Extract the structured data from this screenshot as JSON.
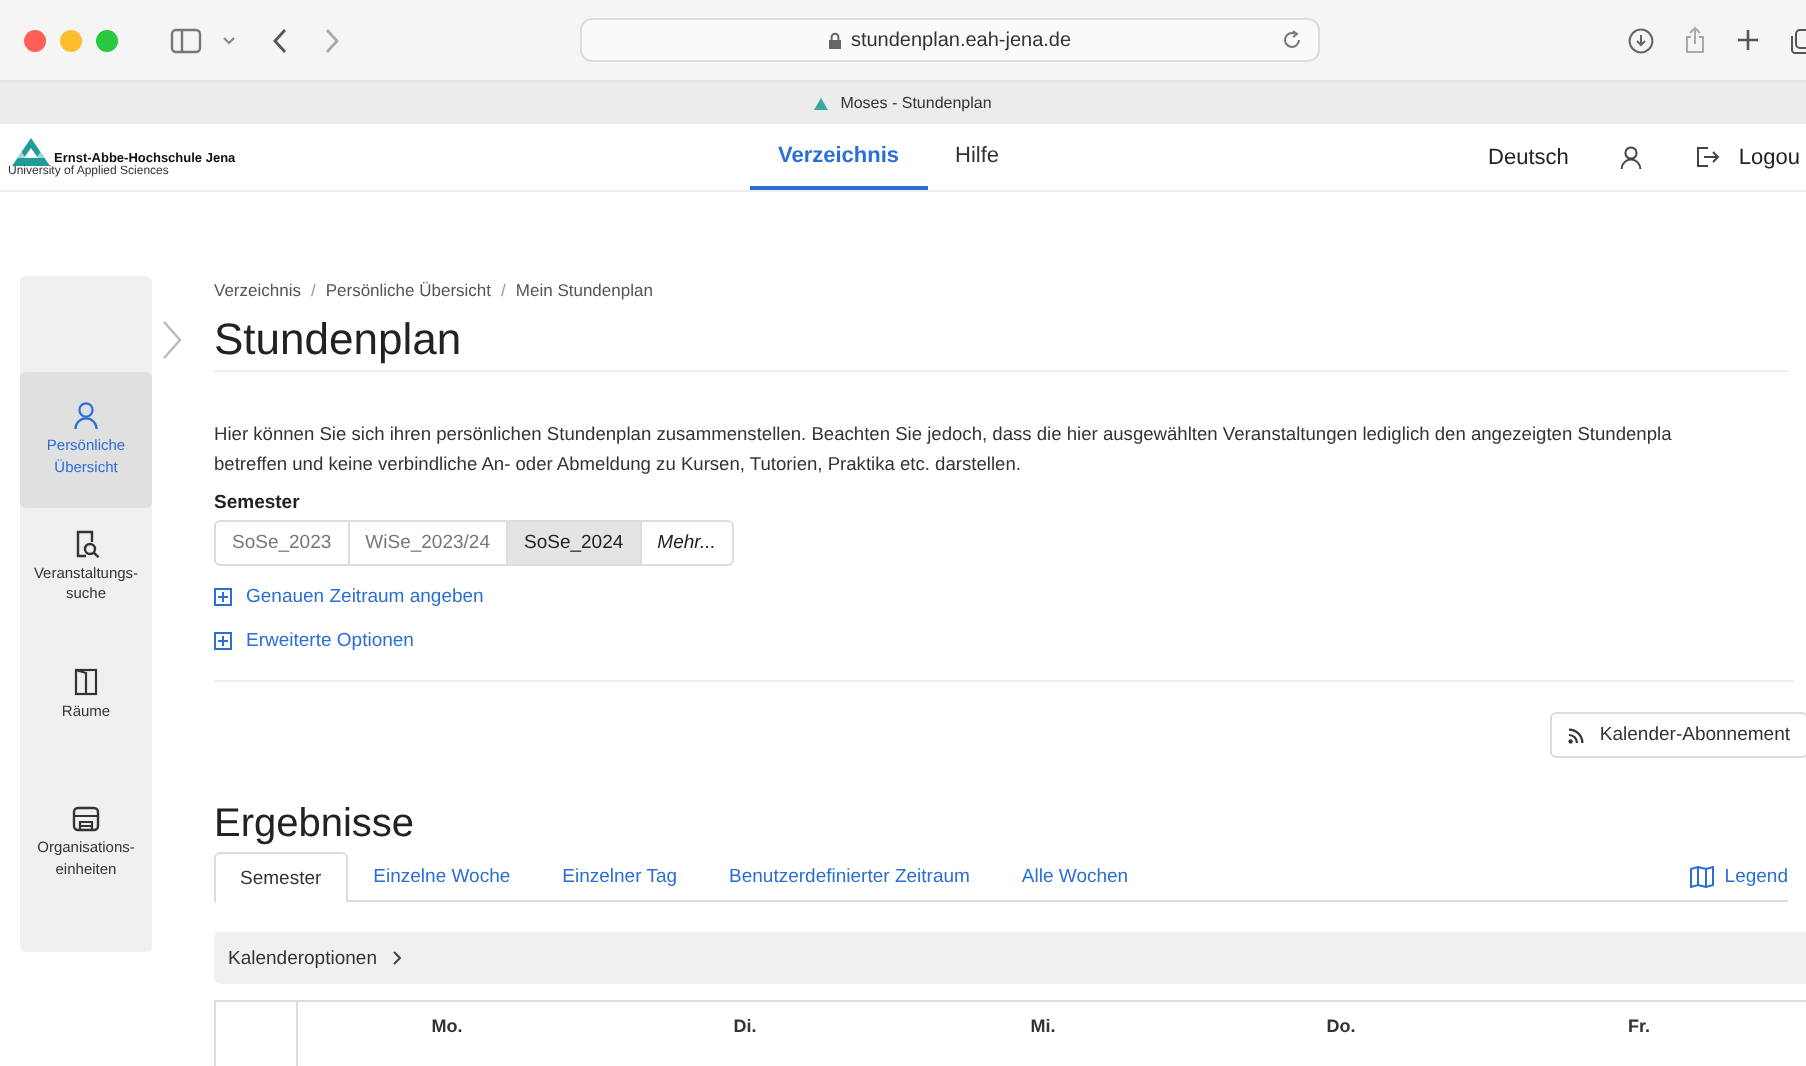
{
  "browser": {
    "url": "stundenplan.eah-jena.de",
    "tab_title": "Moses - Stundenplan"
  },
  "header": {
    "logo_name": "Ernst-Abbe-Hochschule Jena",
    "logo_subtitle": "University of Applied Sciences",
    "nav": [
      {
        "label": "Verzeichnis",
        "selected": true
      },
      {
        "label": "Hilfe",
        "selected": false
      }
    ],
    "language": "Deutsch",
    "logout": "Logou"
  },
  "sidebar": {
    "items": [
      {
        "label": "Persönliche Übersicht",
        "selected": true
      },
      {
        "label": "Veranstaltungs-suche",
        "selected": false
      },
      {
        "label": "Räume",
        "selected": false
      },
      {
        "label": "Organisations-einheiten",
        "selected": false
      }
    ]
  },
  "breadcrumb": [
    {
      "label": "Verzeichnis"
    },
    {
      "separator": "/",
      "label": "Persönliche Übersicht"
    },
    {
      "separator": "/",
      "label": "Mein Stundenplan"
    }
  ],
  "title": "Stundenplan",
  "intro_lines": [
    "Hier können Sie sich ihren persönlichen Stundenplan zusammenstellen. Beachten Sie jedoch, dass die hier ausgewählten Veranstaltungen lediglich den angezeigten Stundenpla",
    "betreffen und keine verbindliche An- oder Abmeldung zu Kursen, Tutorien, Praktika etc. darstellen."
  ],
  "semester": {
    "label": "Semester",
    "options": [
      {
        "label": "SoSe_2023",
        "kind": "option",
        "selected": false
      },
      {
        "label": "WiSe_2023/24",
        "kind": "option",
        "selected": false
      },
      {
        "label": "SoSe_2024",
        "kind": "option",
        "selected": true
      },
      {
        "label": "Mehr...",
        "kind": "more",
        "selected": false
      }
    ]
  },
  "expanders": [
    {
      "label": "Genauen Zeitraum angeben",
      "expanded": false
    },
    {
      "label": "Erweiterte Optionen",
      "expanded": false
    }
  ],
  "subscribe_button": "Kalender-Abonnement",
  "results": {
    "title": "Ergebnisse",
    "tabs": [
      {
        "label": "Semester",
        "selected": true
      },
      {
        "label": "Einzelne Woche",
        "selected": false
      },
      {
        "label": "Einzelner Tag",
        "selected": false
      },
      {
        "label": "Benutzerdefinierter Zeitraum",
        "selected": false
      },
      {
        "label": "Alle Wochen",
        "selected": false
      }
    ],
    "legend": "Legend",
    "calendar_options": "Kalenderoptionen",
    "days": [
      "Mo.",
      "Di.",
      "Mi.",
      "Do.",
      "Fr."
    ]
  }
}
